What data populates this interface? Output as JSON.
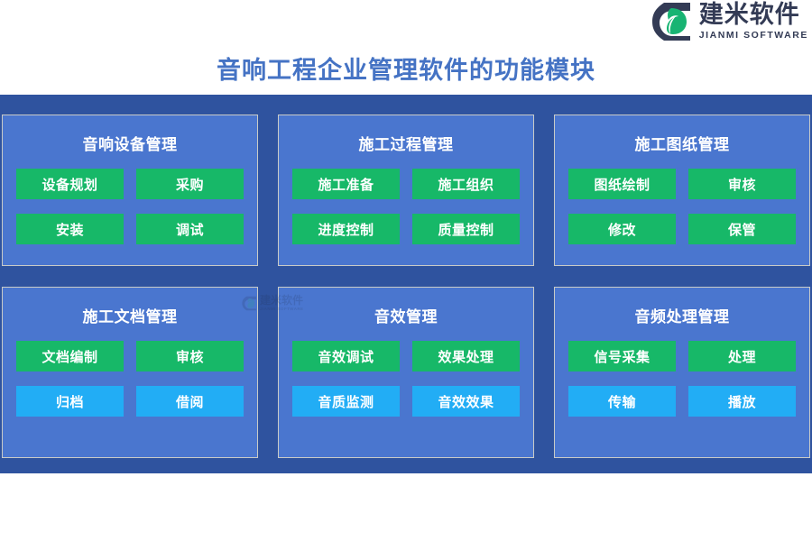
{
  "brand": {
    "logo_icon": "jianmi-hexagon-leaf-logo",
    "name_cn": "建米软件",
    "name_en": "JIANMI SOFTWARE",
    "logo_dark": "#333b55",
    "logo_green": "#18b473"
  },
  "page": {
    "title": "音响工程企业管理软件的功能模块",
    "title_color": "#4573c4",
    "band_color": "#2f539f",
    "card_color": "#4a76cf",
    "card_border_color": "#c9cbc7",
    "green_button_color": "#17b868",
    "blue_button_color": "#22adf5"
  },
  "watermark": {
    "name_cn": "建米软件",
    "name_en": "JIANMI SOFTWARE"
  },
  "cards": [
    {
      "title": "音响设备管理",
      "buttons": [
        {
          "label": "设备规划",
          "color": "green"
        },
        {
          "label": "采购",
          "color": "green"
        },
        {
          "label": "安装",
          "color": "green"
        },
        {
          "label": "调试",
          "color": "green"
        }
      ]
    },
    {
      "title": "施工过程管理",
      "buttons": [
        {
          "label": "施工准备",
          "color": "green"
        },
        {
          "label": "施工组织",
          "color": "green"
        },
        {
          "label": "进度控制",
          "color": "green"
        },
        {
          "label": "质量控制",
          "color": "green"
        }
      ]
    },
    {
      "title": "施工图纸管理",
      "buttons": [
        {
          "label": "图纸绘制",
          "color": "green"
        },
        {
          "label": "审核",
          "color": "green"
        },
        {
          "label": "修改",
          "color": "green"
        },
        {
          "label": "保管",
          "color": "green"
        }
      ]
    },
    {
      "title": "施工文档管理",
      "buttons": [
        {
          "label": "文档编制",
          "color": "green"
        },
        {
          "label": "审核",
          "color": "green"
        },
        {
          "label": "归档",
          "color": "blue"
        },
        {
          "label": "借阅",
          "color": "blue"
        }
      ]
    },
    {
      "title": "音效管理",
      "buttons": [
        {
          "label": "音效调试",
          "color": "green"
        },
        {
          "label": "效果处理",
          "color": "green"
        },
        {
          "label": "音质监测",
          "color": "blue"
        },
        {
          "label": "音效效果",
          "color": "blue"
        }
      ]
    },
    {
      "title": "音频处理管理",
      "buttons": [
        {
          "label": "信号采集",
          "color": "green"
        },
        {
          "label": "处理",
          "color": "green"
        },
        {
          "label": "传输",
          "color": "blue"
        },
        {
          "label": "播放",
          "color": "blue"
        }
      ]
    }
  ]
}
